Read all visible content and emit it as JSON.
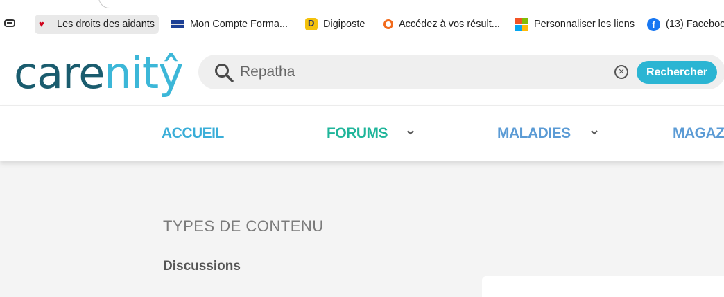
{
  "bookmarks": [
    {
      "label": "Les droits des aidants",
      "icon": "heart-icon"
    },
    {
      "label": "Mon Compte Forma...",
      "icon": "mon-compte-formation-icon"
    },
    {
      "label": "Digiposte",
      "icon": "digiposte-icon"
    },
    {
      "label": "Accédez à vos résult...",
      "icon": "orange-ring-icon"
    },
    {
      "label": "Personnaliser les liens",
      "icon": "microsoft-icon"
    },
    {
      "label": "(13) Faceboo",
      "icon": "facebook-icon"
    }
  ],
  "header": {
    "logo": {
      "part1": "care",
      "part2": "nitŷ"
    },
    "search": {
      "value": "Repatha",
      "button_label": "Rechercher"
    }
  },
  "nav": [
    {
      "label": "ACCUEIL",
      "color": "#3aaed8",
      "has_dropdown": false
    },
    {
      "label": "FORUMS",
      "color": "#1fb59a",
      "has_dropdown": true
    },
    {
      "label": "MALADIES",
      "color": "#5b9bd5",
      "has_dropdown": true
    },
    {
      "label": "MAGAZ",
      "color": "#5b9bd5",
      "has_dropdown": false
    }
  ],
  "content": {
    "section_title": "TYPES DE CONTENU",
    "filter_label": "Discussions"
  },
  "colors": {
    "brand_dark": "#1a5c6e",
    "brand_light": "#3cb7d8",
    "search_button": "#2bb5d3"
  }
}
